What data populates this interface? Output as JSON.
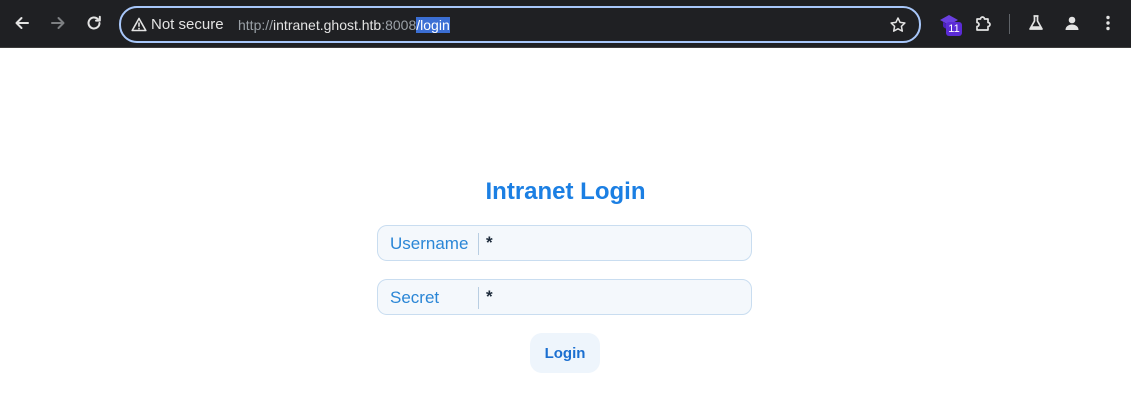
{
  "browser": {
    "security_label": "Not secure",
    "url": {
      "scheme": "http://",
      "host": "intranet.ghost.htb",
      "port": ":8008",
      "path": "/login"
    },
    "extension_badge_count": "11",
    "icons": [
      "back-icon",
      "forward-icon",
      "reload-icon",
      "warning-icon",
      "bookmark-star-icon",
      "extension-icon",
      "puzzle-icon",
      "labs-flask-icon",
      "profile-icon",
      "menu-dots-icon"
    ]
  },
  "page": {
    "title": "Intranet Login",
    "username": {
      "label": "Username",
      "value": "*"
    },
    "secret": {
      "label": "Secret",
      "value": "*"
    },
    "login_label": "Login"
  },
  "colors": {
    "accent": "#1b7fe3",
    "toolbar_bg": "#1f2023",
    "field_bg": "#f4f8fc"
  }
}
